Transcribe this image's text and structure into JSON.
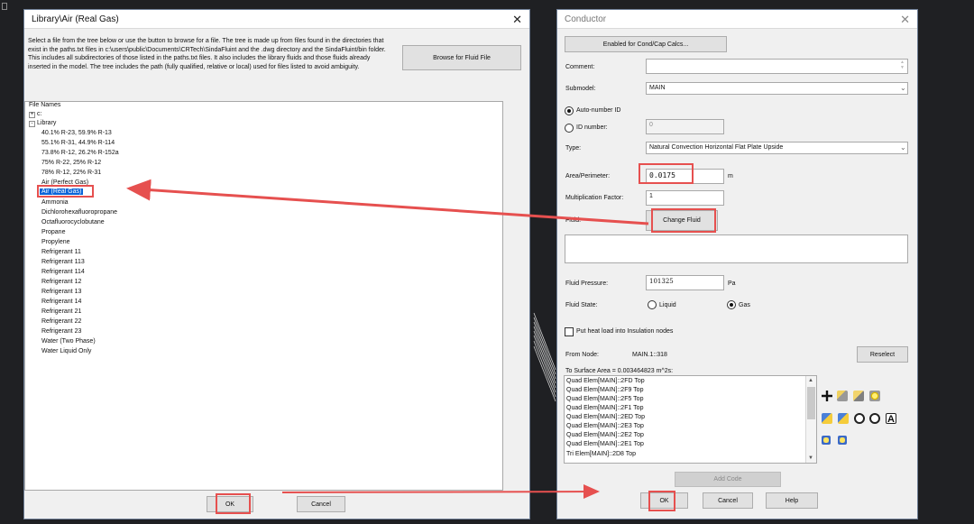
{
  "left_dialog": {
    "title": "Library\\Air (Real Gas)",
    "close": "✕",
    "description": "Select a file from the tree below or use the button to browse for a file. The tree is made up from files found in the directories that exist in the paths.txt files in c:\\users\\public\\Documents\\CRTech\\SindaFluint and the .dwg directory and the SindaFluint/bin folder. This includes all subdirectories of those listed in the paths.txt files. It also includes the library fluids and those fluids already inserted in the model. The tree includes the path (fully qualified, relative or local) used for files listed to avoid ambiguity.",
    "browse_button": "Browse for Fluid File",
    "tree_header": "File Names",
    "tree": {
      "root_c": "c:",
      "library": "Library",
      "items": [
        "40.1% R-23, 59.9% R-13",
        "55.1% R-31, 44.9% R-114",
        "73.8% R-12, 26.2% R-152a",
        "75% R-22, 25% R-12",
        "78% R-12, 22% R-31",
        "Air (Perfect Gas)",
        "Air (Real Gas)",
        "Ammonia",
        "Dichlorohexafluoropropane",
        "Octafluorocyclobutane",
        "Propane",
        "Propylene",
        "Refrigerant 11",
        "Refrigerant 113",
        "Refrigerant 114",
        "Refrigerant 12",
        "Refrigerant 13",
        "Refrigerant 14",
        "Refrigerant 21",
        "Refrigerant 22",
        "Refrigerant 23",
        "Water (Two Phase)",
        "Water Liquid Only"
      ],
      "selected_index": 6
    },
    "ok": "OK",
    "cancel": "Cancel"
  },
  "right_dialog": {
    "title": "Conductor",
    "close": "✕",
    "enable_button": "Enabled for Cond/Cap Calcs...",
    "comment_label": "Comment:",
    "submodel_label": "Submodel:",
    "submodel_value": "MAIN",
    "auto_number": "Auto-number ID",
    "id_number": "ID number:",
    "id_value": "0",
    "type_label": "Type:",
    "type_value": "Natural Convection Horizontal Flat Plate Upside",
    "area_label": "Area/Perimeter:",
    "area_value": "0.0175",
    "area_unit": "m",
    "mult_label": "Multiplication Factor:",
    "mult_value": "1",
    "fluid_label": "Fluid:",
    "change_fluid": "Change Fluid",
    "pressure_label": "Fluid Pressure:",
    "pressure_value": "101325",
    "pressure_unit": "Pa",
    "state_label": "Fluid State:",
    "liquid": "Liquid",
    "gas": "Gas",
    "heat_load": "Put heat load into Insulation nodes",
    "from_node_label": "From Node:",
    "from_node_value": "MAIN.1::318",
    "reselect": "Reselect",
    "surface_area": "To Surface Area =  0.003464823 m^2s:",
    "list_rows": [
      "Quad Elem[MAIN]::2FD  Top",
      "Quad Elem[MAIN]::2F9  Top",
      "Quad Elem[MAIN]::2F5  Top",
      "Quad Elem[MAIN]::2F1  Top",
      "Quad Elem[MAIN]::2ED  Top",
      "Quad Elem[MAIN]::2E3  Top",
      "Quad Elem[MAIN]::2E2  Top",
      "Quad Elem[MAIN]::2E1  Top",
      "Tri Elem[MAIN]::2D8      Top"
    ],
    "add_code": "Add Code",
    "ok": "OK",
    "cancel": "Cancel",
    "help": "Help"
  },
  "colors": {
    "accent_red": "#e6504f",
    "selection_blue": "#0a64d8"
  }
}
